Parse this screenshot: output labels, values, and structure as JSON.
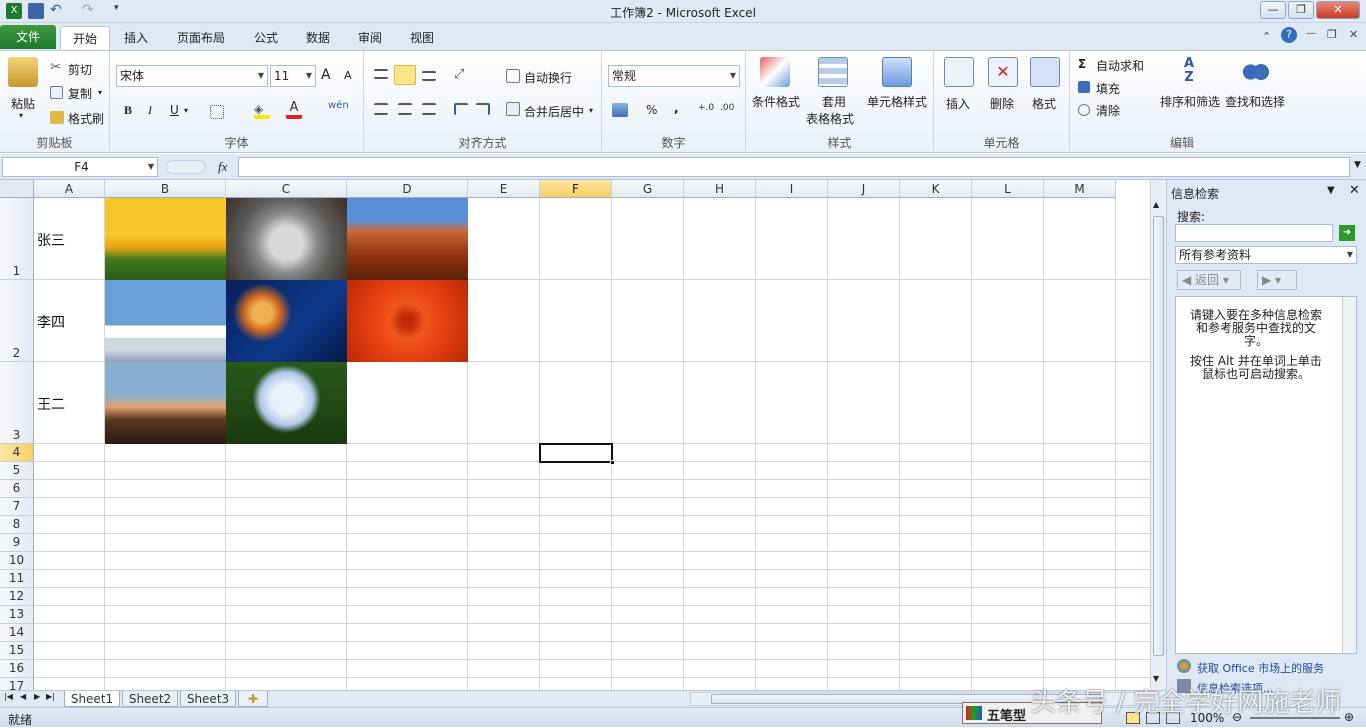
{
  "window": {
    "title": "工作簿2 - Microsoft Excel"
  },
  "tabs": [
    {
      "label": "文件"
    },
    {
      "label": "开始"
    },
    {
      "label": "插入"
    },
    {
      "label": "页面布局"
    },
    {
      "label": "公式"
    },
    {
      "label": "数据"
    },
    {
      "label": "审阅"
    },
    {
      "label": "视图"
    }
  ],
  "ribbon": {
    "clipboard": {
      "group": "剪贴板",
      "paste": "粘贴",
      "cut": "剪切",
      "copy": "复制",
      "format_painter": "格式刷"
    },
    "font": {
      "group": "字体",
      "font_name": "宋体",
      "font_size": "11",
      "bold": "B",
      "italic": "I",
      "underline": "U",
      "grow": "A",
      "shrink": "A"
    },
    "alignment": {
      "group": "对齐方式",
      "wrap": "自动换行",
      "merge": "合并后居中"
    },
    "number": {
      "group": "数字",
      "format": "常规",
      "percent": "%",
      "comma": ","
    },
    "styles": {
      "group": "样式",
      "conditional": "条件格式",
      "table_a": "套用",
      "table_b": "表格格式",
      "cell_styles": "单元格样式"
    },
    "cells": {
      "group": "单元格",
      "insert": "插入",
      "delete": "删除",
      "format": "格式"
    },
    "editing": {
      "group": "编辑",
      "autosum": "自动求和",
      "fill": "填充",
      "clear": "清除",
      "sort": "排序和筛选",
      "find": "查找和选择"
    }
  },
  "formula_bar": {
    "name_box": "F4",
    "fx": "fx",
    "value": ""
  },
  "columns": [
    "A",
    "B",
    "C",
    "D",
    "E",
    "F",
    "G",
    "H",
    "I",
    "J",
    "K",
    "L",
    "M"
  ],
  "rows": [
    "1",
    "2",
    "3",
    "4",
    "5",
    "6",
    "7",
    "8",
    "9",
    "10",
    "11",
    "12",
    "13",
    "14",
    "15",
    "16",
    "17"
  ],
  "cells": {
    "A1": "张三",
    "A2": "李四",
    "A3": "王二"
  },
  "pictures": [
    {
      "name": "tulips",
      "cell": "B1"
    },
    {
      "name": "koala",
      "cell": "C1"
    },
    {
      "name": "desert",
      "cell": "D1"
    },
    {
      "name": "penguins",
      "cell": "B2"
    },
    {
      "name": "jellyfish",
      "cell": "C2"
    },
    {
      "name": "chrysanthemum",
      "cell": "D2"
    },
    {
      "name": "lighthouse",
      "cell": "B3"
    },
    {
      "name": "hydrangeas",
      "cell": "C3"
    }
  ],
  "sheets": [
    {
      "label": "Sheet1"
    },
    {
      "label": "Sheet2"
    },
    {
      "label": "Sheet3"
    }
  ],
  "status": {
    "ready": "就绪",
    "zoom": "100%",
    "ime": "五笔型"
  },
  "research_pane": {
    "title": "信息检索",
    "search_label": "搜索:",
    "search_value": "",
    "source": "所有参考资料",
    "back": "返回",
    "help_p1": "请键入要在多种信息检索和参考服务中查找的文字。",
    "help_p2": "按住 Alt 并在单词上单击鼠标也可启动搜索。",
    "link1": "获取 Office 市场上的服务",
    "link2": "信息检索选项..."
  },
  "watermark": "头条号 / 完全学好网施老师"
}
